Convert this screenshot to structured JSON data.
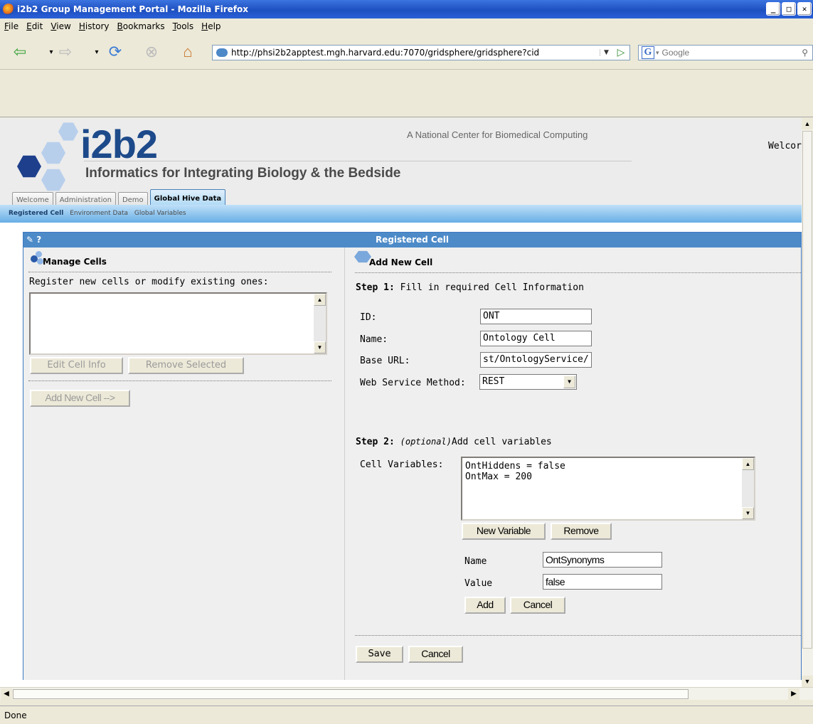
{
  "window": {
    "title": "i2b2 Group Management Portal - Mozilla Firefox",
    "min": "_",
    "max": "□",
    "close": "✕"
  },
  "menu": [
    "File",
    "Edit",
    "View",
    "History",
    "Bookmarks",
    "Tools",
    "Help"
  ],
  "nav": {
    "url": "http://phsi2b2apptest.mgh.harvard.edu:7070/gridsphere/gridsphere?cid",
    "search_placeholder": "Google"
  },
  "header": {
    "logo": "i2b2",
    "subtitle": "Informatics for Integrating Biology & the Bedside",
    "tagline": "A National Center for Biomedical Computing",
    "welcome": "Welcor",
    "tabs": [
      "Welcome",
      "Administration",
      "Demo",
      "Global Hive Data"
    ],
    "subnav": [
      "Registered Cell",
      "Environment Data",
      "Global Variables"
    ]
  },
  "panel": {
    "title": "Registered Cell",
    "icons": "✎ ?",
    "left": {
      "heading": "Manage Cells",
      "intro": "Register new cells or modify existing ones:",
      "edit_btn": "Edit Cell Info",
      "remove_btn": "Remove Selected",
      "add_btn": "Add New Cell -->"
    },
    "right": {
      "heading": "Add New Cell",
      "step1_bold": "Step 1:",
      "step1_text": " Fill in required Cell Information",
      "id_label": "ID:",
      "id_value": "ONT",
      "name_label": "Name:",
      "name_value": "Ontology Cell",
      "url_label": "Base URL:",
      "url_value": "st/OntologyService/",
      "method_label": "Web Service Method:",
      "method_value": "REST",
      "step2_bold": "Step 2:",
      "step2_italic": "(optional)",
      "step2_text": "Add cell variables",
      "vars_label": "Cell Variables:",
      "vars": [
        "OntHiddens = false",
        "OntMax = 200"
      ],
      "new_var_btn": "New Variable",
      "remove_btn": "Remove",
      "var_name_label": "Name",
      "var_name_value": "OntSynonyms",
      "var_value_label": "Value",
      "var_value_value": "false",
      "add_btn": "Add",
      "cancel_btn": "Cancel",
      "save_btn": "Save",
      "cancel_btn2": "Cancel"
    }
  },
  "status": "Done"
}
